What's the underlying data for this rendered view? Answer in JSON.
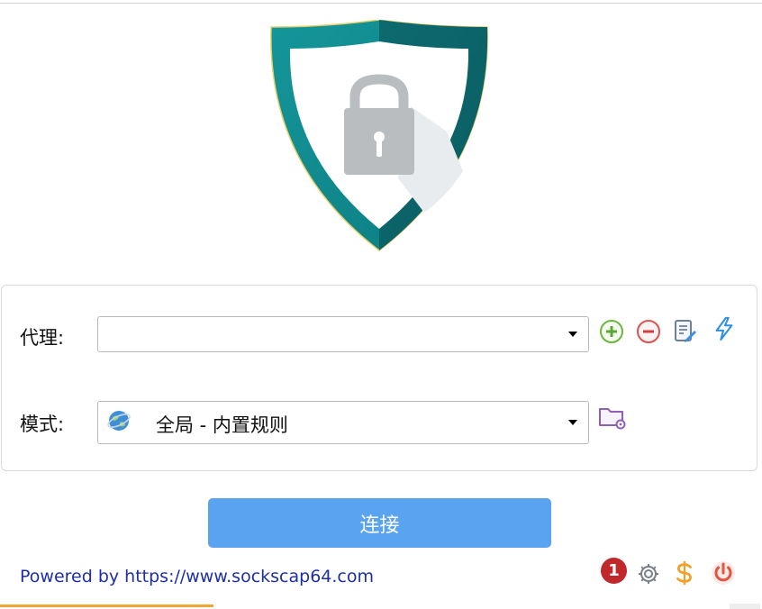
{
  "app": {
    "logo_icon": "shield-lock-icon",
    "colors": {
      "accent": "#5aa3f0",
      "shield_teal": "#0f8a8c",
      "link": "#1d2fa8",
      "badge": "#c0282c",
      "progress": "#f2a630"
    }
  },
  "proxy": {
    "label": "代理:",
    "value": "",
    "icons": [
      "add-icon",
      "remove-icon",
      "edit-icon",
      "lightning-icon"
    ]
  },
  "mode": {
    "label": "模式:",
    "value": "全局 - 内置规则",
    "icon": "globe-icon",
    "folder_icon": "folder-settings-icon"
  },
  "connect": {
    "label": "连接"
  },
  "footer": {
    "link_text": "Powered by https://www.sockscap64.com",
    "badge": "1",
    "icons": [
      "gear-icon",
      "dollar-icon",
      "power-icon"
    ]
  },
  "progress": {
    "fraction": 0.28
  }
}
